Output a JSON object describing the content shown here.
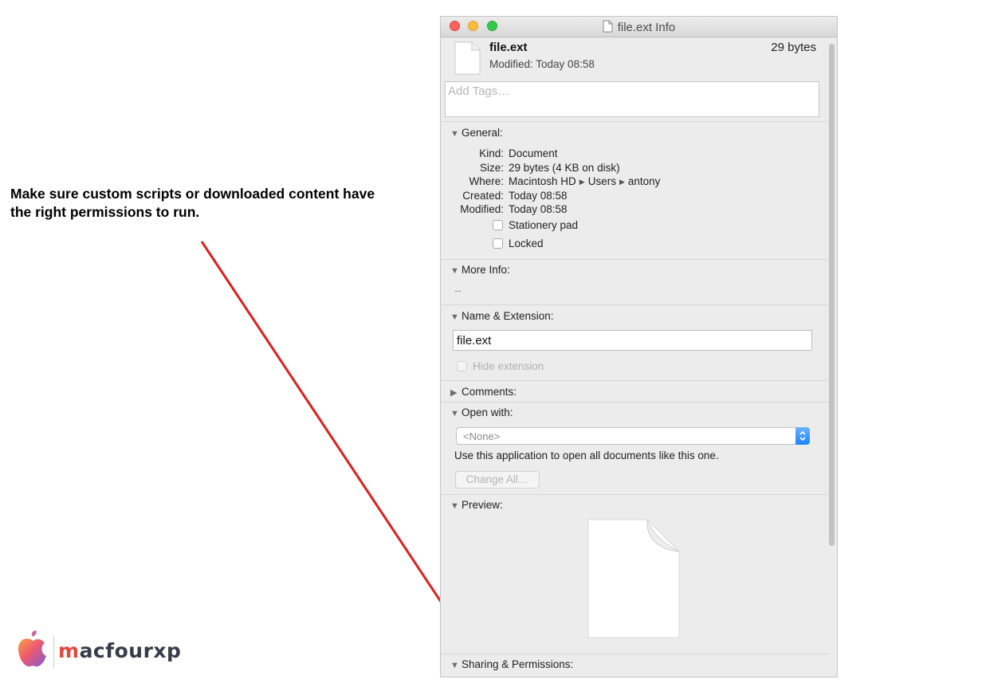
{
  "annotation": {
    "text_line1": "Make sure custom scripts or downloaded content have",
    "text_line2": "the right permissions to run."
  },
  "logo": {
    "m_letter": "m",
    "rest": "acfourxp",
    "brand_color": "#e2483c"
  },
  "window": {
    "title": "file.ext Info",
    "header": {
      "file_name": "file.ext",
      "modified": "Modified: Today 08:58",
      "size": "29 bytes"
    },
    "tags": {
      "placeholder": "Add Tags…"
    },
    "general": {
      "title": "General:",
      "kind_key": "Kind:",
      "kind_val": "Document",
      "size_key": "Size:",
      "size_val": "29 bytes (4 KB on disk)",
      "where_key": "Where:",
      "where_path": [
        "Macintosh HD",
        "Users",
        "antony"
      ],
      "created_key": "Created:",
      "created_val": "Today 08:58",
      "modified_key": "Modified:",
      "modified_val": "Today 08:58",
      "stationery_label": "Stationery pad",
      "locked_label": "Locked"
    },
    "more_info": {
      "title": "More Info:",
      "value": "--"
    },
    "name_ext": {
      "title": "Name & Extension:",
      "value": "file.ext",
      "hide_extension_label": "Hide extension"
    },
    "comments": {
      "title": "Comments:"
    },
    "open_with": {
      "title": "Open with:",
      "selected": "<None>",
      "description": "Use this application to open all documents like this one.",
      "change_all_label": "Change All…"
    },
    "preview": {
      "title": "Preview:"
    },
    "sharing": {
      "title": "Sharing & Permissions:"
    }
  },
  "colors": {
    "arrow": "#e01e1e",
    "window_bg": "#ececec",
    "popup_accent": "#1a82fb"
  }
}
